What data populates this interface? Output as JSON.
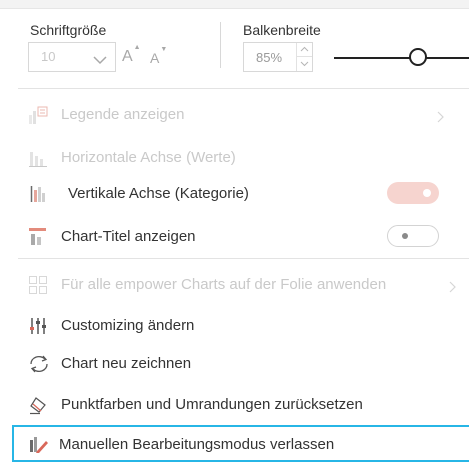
{
  "font_size": {
    "label": "Schriftgröße",
    "value": "10",
    "increase_label": "A",
    "decrease_label": "A"
  },
  "bar_width": {
    "label": "Balkenbreite",
    "value": "85%",
    "slider_level": 0.62
  },
  "menu": {
    "legend": "Legende anzeigen",
    "horizontal_axis": "Horizontale Achse (Werte)",
    "vertical_axis": "Vertikale Achse (Kategorie)",
    "chart_title": "Chart-Titel anzeigen",
    "apply_all": "Für alle empower Charts auf der Folie anwenden",
    "customizing": "Customizing ändern",
    "redraw": "Chart neu zeichnen",
    "reset_colors": "Punktfarben und Umrandungen zurücksetzen",
    "exit_manual": "Manuellen Bearbeitungsmodus verlassen"
  },
  "colors": {
    "accent_highlight": "#27b6e6",
    "toggle_on": "#f6d4cf",
    "disabled_text": "#c9c9c9"
  }
}
